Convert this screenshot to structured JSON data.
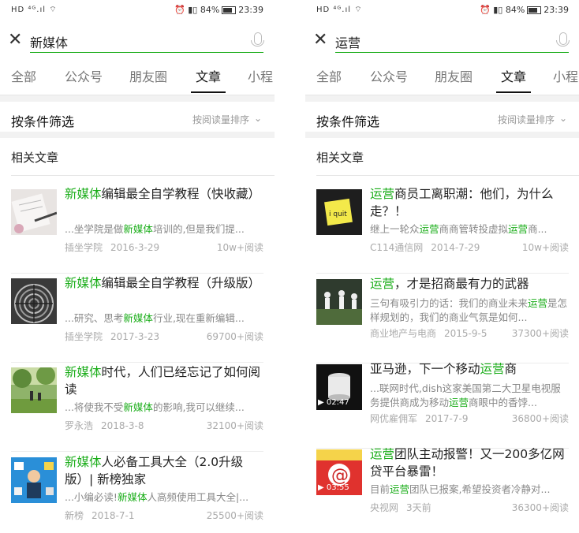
{
  "status_bar": {
    "left_icons": "HD ⁴ᴳ.ıl ⌔",
    "right_icons": "⏰ ▮▯ 84%",
    "time": "23:39"
  },
  "colors": {
    "highlight": "#1aad19",
    "bg_separator": "#f2f2f2"
  },
  "left": {
    "query": "新媒体",
    "tabs": [
      "全部",
      "公众号",
      "朋友圈",
      "文章",
      "小程"
    ],
    "active_tab": "文章",
    "filter_label": "按条件筛选",
    "sort_label": "按阅读量排序",
    "section_title": "相关文章",
    "articles": [
      {
        "title_hl": "新媒体",
        "title_rest": "编辑最全自学教程（快收藏）",
        "snippet_pre": "...坐学院是做",
        "snippet_hl": "新媒体",
        "snippet_post": "培训的,但是我们提...",
        "source": "插坐学院",
        "date": "2016-3-29",
        "reads": "10w+阅读",
        "thumb": "notebook-photo"
      },
      {
        "title_hl": "新媒体",
        "title_rest": "编辑最全自学教程（升级版）",
        "snippet_pre": "...研究、思考",
        "snippet_hl": "新媒体",
        "snippet_post": "行业,现在重新编辑...",
        "source": "插坐学院",
        "date": "2017-3-23",
        "reads": "69700+阅读",
        "thumb": "tree-rings-photo"
      },
      {
        "title_hl": "新媒体",
        "title_rest": "时代，人们已经忘记了如何阅读",
        "snippet_pre": "...将使我不受",
        "snippet_hl": "新媒体",
        "snippet_post": "的影响,我可以继续...",
        "source": "罗永浩",
        "date": "2018-3-8",
        "reads": "32100+阅读",
        "thumb": "park-photo"
      },
      {
        "title_hl": "新媒体",
        "title_rest": "人必备工具大全（2.0升级版）| 新榜独家",
        "snippet_pre": "...小编必读!",
        "snippet_hl": "新媒体",
        "snippet_post": "人高频使用工具大全|...",
        "source": "新榜",
        "date": "2018-7-1",
        "reads": "25500+阅读",
        "thumb": "tools-illustration"
      }
    ]
  },
  "right": {
    "query": "运营",
    "tabs": [
      "全部",
      "公众号",
      "朋友圈",
      "文章",
      "小程"
    ],
    "active_tab": "文章",
    "filter_label": "按条件筛选",
    "sort_label": "按阅读量排序",
    "section_title": "相关文章",
    "articles": [
      {
        "title_hl": "运营",
        "title_rest": "商员工离职潮：他们，为什么走？！",
        "snippet_html": [
          "继上一轮众",
          "运营",
          "商商管转投虚拟",
          "运营",
          "商..."
        ],
        "source": "C114通信网",
        "date": "2014-7-29",
        "reads": "10w+阅读",
        "thumb_text": "i quit"
      },
      {
        "title_hl": "运营",
        "title_rest": "，才是招商最有力的武器",
        "snippet_html": [
          "三句有吸引力的话：我们的商业未来",
          "运营",
          "是怎样规划的，我们的商业气氛是如何..."
        ],
        "source": "商业地产与电商",
        "date": "2015-9-5",
        "reads": "37300+阅读",
        "thumb": "tai-chi-photo"
      },
      {
        "title_pre": "亚马逊，下一个移动",
        "title_hl": "运营",
        "title_rest": "商",
        "snippet_html": [
          "...联网时代,dish这家美国第二大卫星电视服务提供商成为移动",
          "运营",
          "商眼中的香饽..."
        ],
        "source": "网优雇佣军",
        "date": "2017-7-9",
        "reads": "36800+阅读",
        "video_time": "▶ 02:47"
      },
      {
        "title_hl": "运营",
        "title_rest": "团队主动报警！又一200多亿网贷平台暴雷！",
        "snippet_html": [
          "目前",
          "运营",
          "团队已报案,希望投资者冷静对..."
        ],
        "source": "央视网",
        "date": "3天前",
        "reads": "36300+阅读",
        "video_time": "▶ 03:55"
      }
    ]
  }
}
